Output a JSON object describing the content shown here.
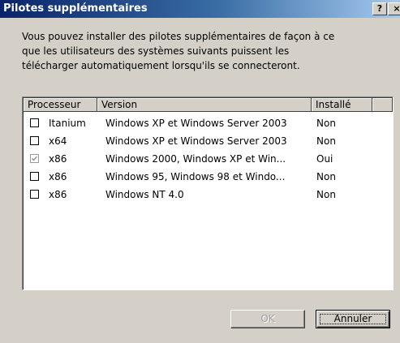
{
  "window": {
    "title": "Pilotes supplémentaires",
    "help_label": "?",
    "close_label": "×"
  },
  "description": "Vous pouvez installer des pilotes supplémentaires de façon à ce\nque les utilisateurs des systèmes suivants puissent les\ntélécharger automatiquement lorsqu'ils se connecteront.",
  "list": {
    "headers": {
      "processor": "Processeur",
      "version": "Version",
      "installed": "Installé"
    },
    "rows": [
      {
        "checked": false,
        "processor": "Itanium",
        "version": "Windows XP et Windows Server 2003",
        "installed": "Non"
      },
      {
        "checked": false,
        "processor": "x64",
        "version": "Windows XP et Windows Server 2003",
        "installed": "Non"
      },
      {
        "checked": true,
        "processor": "x86",
        "version": "Windows 2000, Windows XP et Win...",
        "installed": "Oui"
      },
      {
        "checked": false,
        "processor": "x86",
        "version": "Windows 95, Windows 98 et Windo...",
        "installed": "Non"
      },
      {
        "checked": false,
        "processor": "x86",
        "version": "Windows NT 4.0",
        "installed": "Non"
      }
    ]
  },
  "buttons": {
    "ok": "OK",
    "cancel": "Annuler"
  },
  "colors": {
    "titlebar_start": "#0a246a",
    "titlebar_end": "#a6caf0",
    "dialog_bg": "#d4d0c8"
  }
}
